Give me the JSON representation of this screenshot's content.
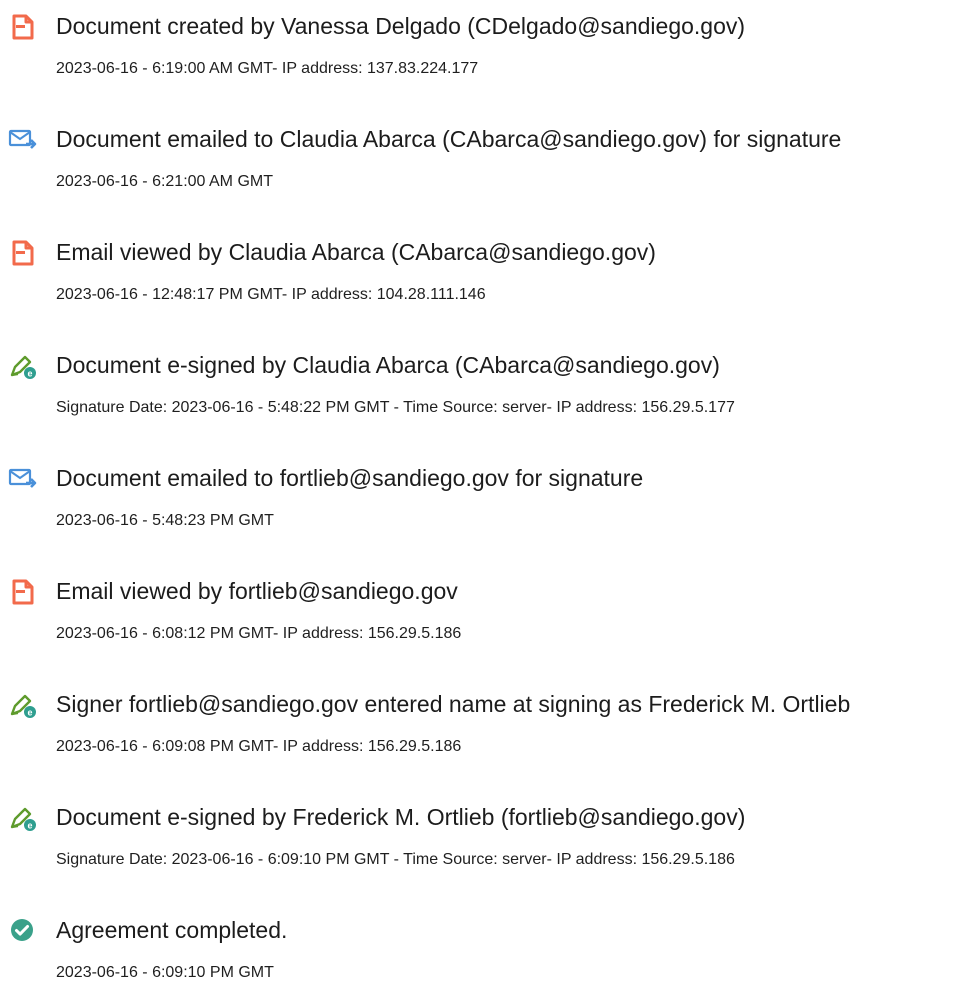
{
  "events": [
    {
      "icon": "document-icon",
      "title": "Document created by Vanessa Delgado (CDelgado@sandiego.gov)",
      "detail": "2023-06-16 - 6:19:00 AM GMT- IP address: 137.83.224.177"
    },
    {
      "icon": "email-sent-icon",
      "title": "Document emailed to Claudia Abarca (CAbarca@sandiego.gov) for signature",
      "detail": "2023-06-16 - 6:21:00 AM GMT"
    },
    {
      "icon": "document-icon",
      "title": "Email viewed by Claudia Abarca (CAbarca@sandiego.gov)",
      "detail": "2023-06-16 - 12:48:17 PM GMT- IP address: 104.28.111.146"
    },
    {
      "icon": "e-sign-icon",
      "title": "Document e-signed by Claudia Abarca (CAbarca@sandiego.gov)",
      "detail": "Signature Date: 2023-06-16 - 5:48:22 PM GMT - Time Source: server- IP address: 156.29.5.177"
    },
    {
      "icon": "email-sent-icon",
      "title": "Document emailed to fortlieb@sandiego.gov for signature",
      "detail": "2023-06-16 - 5:48:23 PM GMT"
    },
    {
      "icon": "document-icon",
      "title": "Email viewed by fortlieb@sandiego.gov",
      "detail": "2023-06-16 - 6:08:12 PM GMT- IP address: 156.29.5.186"
    },
    {
      "icon": "e-sign-icon",
      "title": "Signer fortlieb@sandiego.gov entered name at signing as Frederick M. Ortlieb",
      "detail": "2023-06-16 - 6:09:08 PM GMT- IP address: 156.29.5.186"
    },
    {
      "icon": "e-sign-icon",
      "title": "Document e-signed by Frederick M. Ortlieb (fortlieb@sandiego.gov)",
      "detail": "Signature Date: 2023-06-16 - 6:09:10 PM GMT - Time Source: server- IP address: 156.29.5.186"
    },
    {
      "icon": "check-circle-icon",
      "title": "Agreement completed.",
      "detail": "2023-06-16 - 6:09:10 PM GMT"
    }
  ],
  "colors": {
    "document_icon": "#f26a4b",
    "email_icon": "#4a90d9",
    "esign_icon": "#5e9b2c",
    "esign_badge": "#2e9e8f",
    "complete_icon": "#3aa18a"
  }
}
